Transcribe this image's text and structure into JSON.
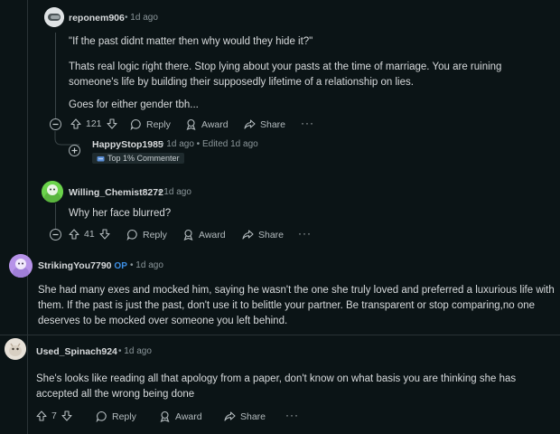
{
  "comments": [
    {
      "username": "reponem906",
      "time": "1d ago",
      "paragraphs": [
        "\"If the past didnt matter then why would they hide it?\"",
        "Thats real logic right there. Stop lying about your pasts at the time of marriage. You are ruining someone's life by building their supposedly lifetime of a relationship on lies.",
        "Goes for either gender tbh..."
      ],
      "votes": "121",
      "reply": "Reply",
      "award": "Award",
      "share": "Share",
      "more": "···"
    },
    {
      "username": "HappyStop1985",
      "time": "1d ago",
      "edited": "Edited 1d ago",
      "badge": "Top 1% Commenter"
    },
    {
      "username": "Willing_Chemist8272",
      "time": "1d ago",
      "paragraphs": [
        "Why her face blurred?"
      ],
      "votes": "41",
      "reply": "Reply",
      "award": "Award",
      "share": "Share",
      "more": "···"
    },
    {
      "username": "StrikingYou7790",
      "op": "OP",
      "time": "1d ago",
      "paragraphs": [
        "She had many exes and mocked him, saying he wasn't the one she truly loved and preferred a luxurious life with them. If the past is just the past, don't use it to belittle your partner. Be transparent or stop comparing,no one deserves to be mocked over someone you left behind."
      ]
    },
    {
      "username": "Used_Spinach924",
      "time": "1d ago",
      "paragraphs": [
        "She's looks like reading all that apology from a paper, don't know on what basis you are thinking she has accepted all the wrong being done"
      ],
      "votes": "7",
      "reply": "Reply",
      "award": "Award",
      "share": "Share",
      "more": "···"
    }
  ],
  "separator_dot": "•",
  "collapse_symbol": "⊖",
  "expand_symbol": "+",
  "colors": {
    "background": "#0b1416",
    "text": "#d7dadc",
    "meta": "#8b969a",
    "op": "#3d8fe5",
    "avatar_green": "#6bd34b",
    "avatar_purple": "#b692e8"
  }
}
